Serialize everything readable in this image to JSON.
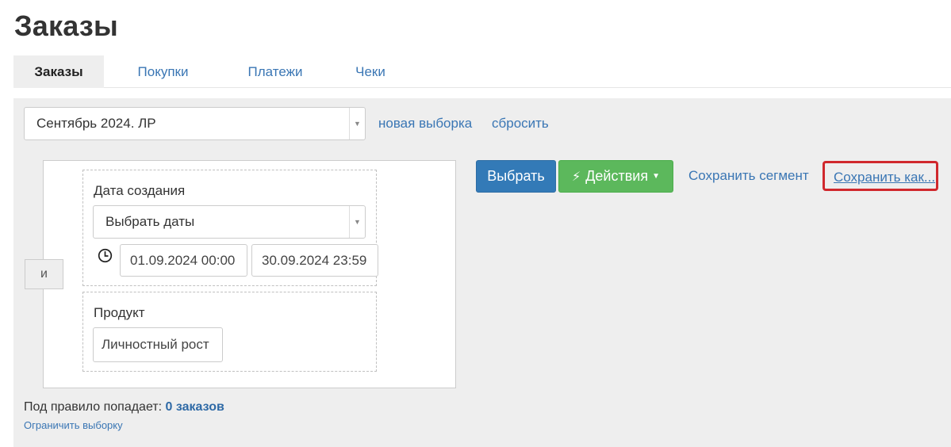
{
  "page": {
    "title": "Заказы"
  },
  "tabs": [
    {
      "label": "Заказы",
      "active": true
    },
    {
      "label": "Покупки",
      "active": false
    },
    {
      "label": "Платежи",
      "active": false
    },
    {
      "label": "Чеки",
      "active": false
    }
  ],
  "segment": {
    "selected": "Сентябрь 2024. ЛР",
    "new_selection_link": "новая выборка",
    "reset_link": "сбросить"
  },
  "rule": {
    "and_label": "и",
    "date_condition": {
      "label": "Дата создания",
      "select_value": "Выбрать даты",
      "from_value": "01.09.2024 00:00",
      "to_value": "30.09.2024 23:59"
    },
    "product_condition": {
      "label": "Продукт",
      "value": "Личностный рост"
    }
  },
  "actions": {
    "select_button": "Выбрать",
    "actions_button": "Действия",
    "save_segment_link": "Сохранить сегмент",
    "save_as_link": "Сохранить как..."
  },
  "footer": {
    "matches_prefix": "Под правило попадает:",
    "matches_count": "0 заказов",
    "limit_link": "Ограничить выборку"
  },
  "colors": {
    "primary": "#337ab7",
    "success": "#5cb85c",
    "link": "#3a76b4",
    "highlight": "#d0282d"
  },
  "icons": {
    "select_arrow": "chevron-down-icon",
    "clock": "clock-icon",
    "actions": "bolt-icon",
    "caret": "caret-down-icon"
  }
}
